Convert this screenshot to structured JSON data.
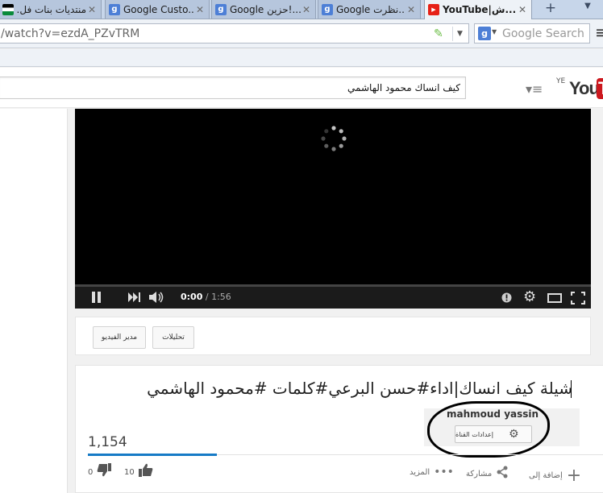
{
  "browser": {
    "tabs": [
      {
        "title": "منتديات بنات فل...",
        "favicon": "flag-icon"
      },
      {
        "title": "Google Custo...",
        "favicon": "google-icon"
      },
      {
        "title": "Google حزين!...",
        "favicon": "google-icon"
      },
      {
        "title": "Google نظرت... ",
        "favicon": "google-icon"
      },
      {
        "title": "YouTube|ش...",
        "favicon": "youtube-icon",
        "active": true
      }
    ],
    "close_glyph": "✕",
    "new_tab": "+",
    "url": "/watch?v=ezdA_PZvTRM",
    "search_placeholder": "Google Search"
  },
  "youtube": {
    "search_value": "كيف انساك محمود الهاشمي",
    "logo_ye": "YE",
    "logo_text": "You",
    "logo_tube": "T",
    "player": {
      "time_current": "0:00",
      "time_total": "1:56",
      "state": "loading"
    },
    "owner_bar": {
      "analytics_label": "تحليلات",
      "video_manager_label": "مدير الفيديو"
    },
    "video": {
      "title": "شيلة كيف انساك|اداء#حسن البرعي#كلمات #محمود الهاشمي",
      "channel": "mahmoud yassin",
      "channel_settings_label": "إعدادات القناة",
      "views": "1,154",
      "likes": "10",
      "dislikes": "0",
      "add_to_label": "إضافة إلى",
      "share_label": "مشاركة",
      "more_label": "المزيد"
    }
  },
  "colors": {
    "youtube_red": "#cc181e",
    "view_bar_blue": "#167ac6"
  }
}
